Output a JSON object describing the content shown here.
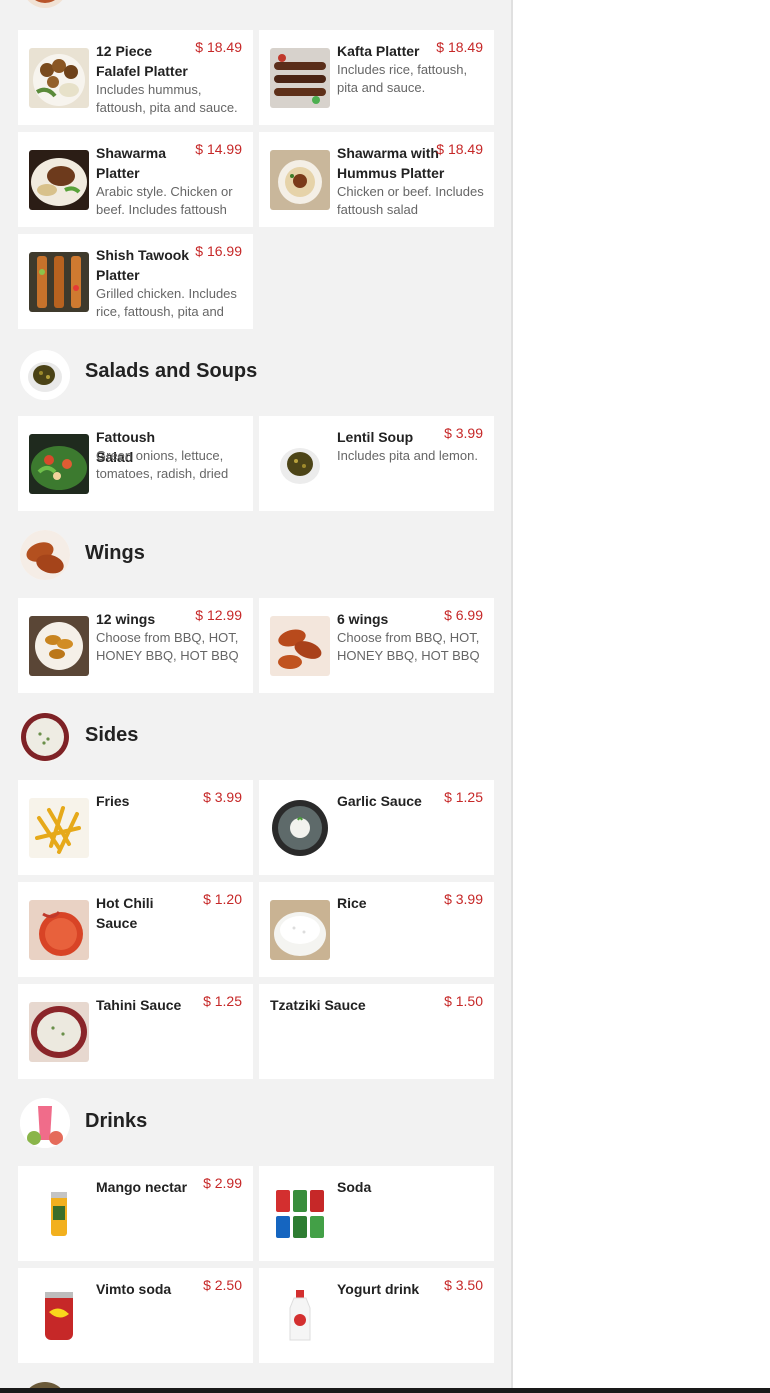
{
  "sections": {
    "salads": {
      "title": "Salads and Soups"
    },
    "wings": {
      "title": "Wings"
    },
    "sides": {
      "title": "Sides"
    },
    "drinks": {
      "title": "Drinks"
    }
  },
  "items": {
    "falafel": {
      "name": "12 Piece Falafel Platter",
      "price": "$ 18.49",
      "desc": "Includes hummus, fattoush, pita and sauce."
    },
    "kafta": {
      "name": "Kafta Platter",
      "price": "$ 18.49",
      "desc": "Includes rice, fattoush, pita and sauce."
    },
    "shawarma": {
      "name": "Shawarma Platter",
      "price": "$ 14.99",
      "desc": "Arabic style. Chicken or beef. Includes fattoush"
    },
    "shawarma_hummus": {
      "name": "Shawarma with Hummus Platter",
      "price": "$ 18.49",
      "desc": "Chicken or beef. Includes fattoush salad"
    },
    "shish": {
      "name": "Shish Tawook Platter",
      "price": "$ 16.99",
      "desc": "Grilled chicken. Includes rice, fattoush, pita and"
    },
    "fattoush": {
      "name": "Fattoush Salad",
      "price": "",
      "desc": "Green onions, lettuce, tomatoes, radish, dried"
    },
    "lentil": {
      "name": "Lentil Soup",
      "price": "$ 3.99",
      "desc": "Includes pita and lemon."
    },
    "wings12": {
      "name": "12 wings",
      "price": "$ 12.99",
      "desc": "Choose from BBQ, HOT, HONEY BBQ, HOT BBQ"
    },
    "wings6": {
      "name": "6 wings",
      "price": "$ 6.99",
      "desc": "Choose from BBQ, HOT, HONEY BBQ, HOT BBQ"
    },
    "fries": {
      "name": "Fries",
      "price": "$ 3.99"
    },
    "garlic": {
      "name": "Garlic Sauce",
      "price": "$ 1.25"
    },
    "hotchili": {
      "name": "Hot Chili Sauce",
      "price": "$ 1.20"
    },
    "rice": {
      "name": "Rice",
      "price": "$ 3.99"
    },
    "tahini": {
      "name": "Tahini Sauce",
      "price": "$ 1.25"
    },
    "tzatziki": {
      "name": "Tzatziki Sauce",
      "price": "$ 1.50"
    },
    "mango": {
      "name": "Mango nectar",
      "price": "$ 2.99"
    },
    "soda": {
      "name": "Soda",
      "price": ""
    },
    "vimto": {
      "name": "Vimto soda",
      "price": "$ 2.50"
    },
    "yogurt": {
      "name": "Yogurt drink",
      "price": "$ 3.50"
    }
  },
  "icons": {
    "falafel": "falafel-plate-photo",
    "kafta": "kafta-skewers-photo",
    "shawarma": "shawarma-plate-photo",
    "shawarma_hummus": "hummus-bowl-photo",
    "shish": "chicken-skewers-photo",
    "fattoush": "salad-bowl-photo",
    "lentil": "soup-bowl-photo",
    "wings12": "wings-plate-photo",
    "wings6": "wings-photo",
    "fries": "fries-photo",
    "garlic": "garlic-sauce-photo",
    "hotchili": "chili-sauce-photo",
    "rice": "rice-bowl-photo",
    "tahini": "tahini-bowl-photo",
    "mango": "mango-can-photo",
    "soda": "soda-cans-photo",
    "vimto": "vimto-can-photo",
    "yogurt": "yogurt-bottle-photo"
  },
  "colors": {
    "price": "#c62828",
    "background": "#f2f2f2",
    "card": "#ffffff"
  }
}
